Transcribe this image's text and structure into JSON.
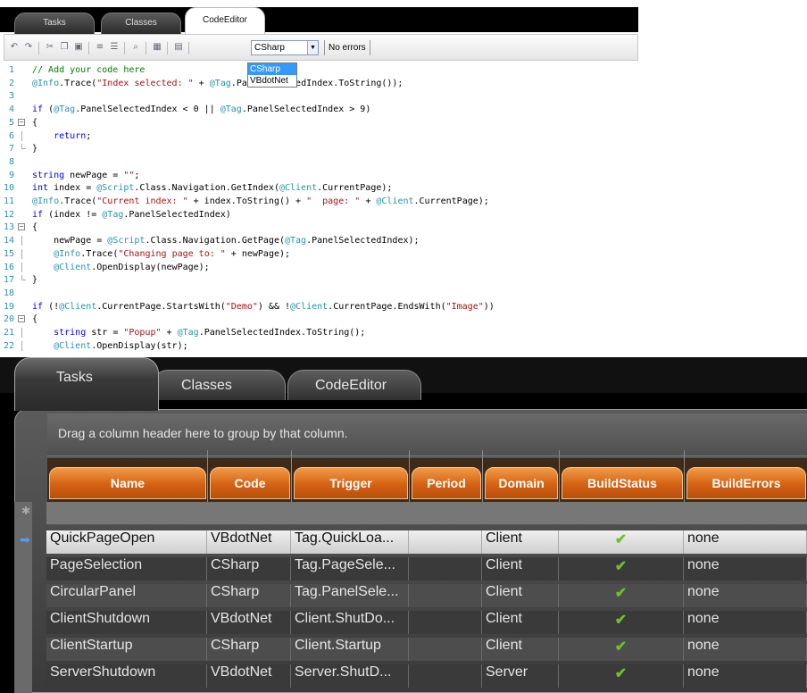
{
  "top": {
    "tabs": [
      {
        "label": "Tasks",
        "active": false
      },
      {
        "label": "Classes",
        "active": false
      },
      {
        "label": "CodeEditor",
        "active": true
      }
    ],
    "language_select": {
      "value": "CSharp",
      "options": [
        "CSharp",
        "VBdotNet"
      ]
    },
    "status_text": "No errors",
    "toolbar_icons": [
      "undo-icon",
      "redo-icon",
      "cut-icon",
      "copy-icon",
      "paste-icon",
      "indent-icon",
      "outdent-icon",
      "find-icon",
      "calculator-icon",
      "list-icon"
    ],
    "code_lines": [
      {
        "n": "1",
        "text": "// Add your code here"
      },
      {
        "n": "2",
        "text": "@Info.Trace(\"Index selected: \" + @Tag.PanelSelectedIndex.ToString());"
      },
      {
        "n": "3",
        "text": ""
      },
      {
        "n": "4",
        "text": "if (@Tag.PanelSelectedIndex < 0 || @Tag.PanelSelectedIndex > 9)"
      },
      {
        "n": "5",
        "text": "{"
      },
      {
        "n": "6",
        "text": "    return;"
      },
      {
        "n": "7",
        "text": "}"
      },
      {
        "n": "8",
        "text": ""
      },
      {
        "n": "9",
        "text": "string newPage = \"\";"
      },
      {
        "n": "10",
        "text": "int index = @Script.Class.Navigation.GetIndex(@Client.CurrentPage);"
      },
      {
        "n": "11",
        "text": "@Info.Trace(\"Current index: \" + index.ToString() + \"  page: \" + @Client.CurrentPage);"
      },
      {
        "n": "12",
        "text": "if (index != @Tag.PanelSelectedIndex)"
      },
      {
        "n": "13",
        "text": "{"
      },
      {
        "n": "14",
        "text": "    newPage = @Script.Class.Navigation.GetPage(@Tag.PanelSelectedIndex);"
      },
      {
        "n": "15",
        "text": "    @Info.Trace(\"Changing page to: \" + newPage);"
      },
      {
        "n": "16",
        "text": "    @Client.OpenDisplay(newPage);"
      },
      {
        "n": "17",
        "text": "}"
      },
      {
        "n": "18",
        "text": ""
      },
      {
        "n": "19",
        "text": "if (!@Client.CurrentPage.StartsWith(\"Demo\") && !@Client.CurrentPage.EndsWith(\"Image\"))"
      },
      {
        "n": "20",
        "text": "{"
      },
      {
        "n": "21",
        "text": "    string str = \"Popup\" + @Tag.PanelSelectedIndex.ToString();"
      },
      {
        "n": "22",
        "text": "    @Client.OpenDisplay(str);"
      }
    ]
  },
  "bottom": {
    "tabs": [
      {
        "label": "Tasks",
        "active": true
      },
      {
        "label": "Classes",
        "active": false
      },
      {
        "label": "CodeEditor",
        "active": false
      }
    ],
    "group_hint": "Drag a column header here to group by that column.",
    "columns": [
      "Name",
      "Code",
      "Trigger",
      "Period",
      "Domain",
      "BuildStatus",
      "BuildErrors"
    ],
    "rows": [
      {
        "name": "QuickPageOpen",
        "code": "VBdotNet",
        "trigger": "Tag.QuickLoa...",
        "period": "",
        "domain": "Client",
        "build_status": "ok",
        "build_errors": "none"
      },
      {
        "name": "PageSelection",
        "code": "CSharp",
        "trigger": "Tag.PageSele...",
        "period": "",
        "domain": "Client",
        "build_status": "ok",
        "build_errors": "none"
      },
      {
        "name": "CircularPanel",
        "code": "CSharp",
        "trigger": "Tag.PanelSele...",
        "period": "",
        "domain": "Client",
        "build_status": "ok",
        "build_errors": "none"
      },
      {
        "name": "ClientShutdown",
        "code": "VBdotNet",
        "trigger": "Client.ShutDo...",
        "period": "",
        "domain": "Client",
        "build_status": "ok",
        "build_errors": "none"
      },
      {
        "name": "ClientStartup",
        "code": "CSharp",
        "trigger": "Client.Startup",
        "period": "",
        "domain": "Client",
        "build_status": "ok",
        "build_errors": "none"
      },
      {
        "name": "ServerShutdown",
        "code": "VBdotNet",
        "trigger": "Server.ShutD...",
        "period": "",
        "domain": "Server",
        "build_status": "ok",
        "build_errors": "none"
      }
    ],
    "status_icon": "checkmark-icon",
    "colors": {
      "header_orange": "#d46214",
      "check_green": "#6ec02a",
      "selected_row": "#e6e6e6"
    }
  }
}
